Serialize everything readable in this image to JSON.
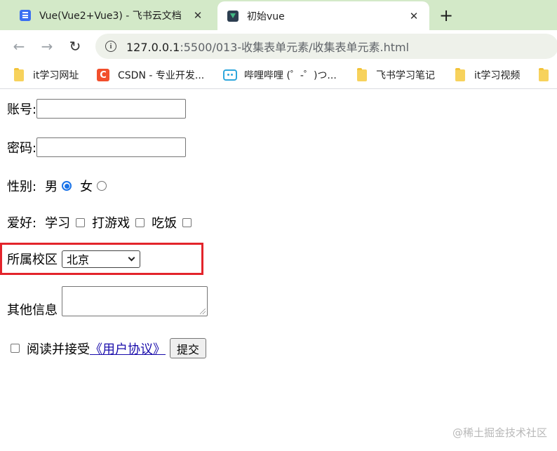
{
  "browser": {
    "tabs": [
      {
        "title": "Vue(Vue2+Vue3) - 飞书云文档",
        "icon": "doc-icon",
        "close": "✕"
      },
      {
        "title": "初始vue",
        "icon": "vue-icon",
        "close": "✕"
      }
    ],
    "new_tab": "+",
    "nav": {
      "back": "←",
      "forward": "→",
      "reload": "↻"
    },
    "url_host": "127.0.0.1",
    "url_rest": ":5500/013-收集表单元素/收集表单元素.html",
    "bookmarks": [
      {
        "label": "it学习网址",
        "icon": "folder-icon"
      },
      {
        "label": "CSDN - 专业开发...",
        "icon": "csdn-icon"
      },
      {
        "label": "哔哩哔哩 (゜-゜)つ...",
        "icon": "bilibili-icon"
      },
      {
        "label": "飞书学习笔记",
        "icon": "folder-icon"
      },
      {
        "label": "it学习视频",
        "icon": "folder-icon"
      }
    ],
    "csdn_letter": "C",
    "accent": "#1a73e8",
    "tab_bar_color": "#d3e9c8"
  },
  "form": {
    "account_label": "账号:",
    "account_value": "",
    "password_label": "密码:",
    "password_value": "",
    "gender_label": "性别:",
    "gender_options": [
      "男",
      "女"
    ],
    "gender_selected": "男",
    "hobby_label": "爱好:",
    "hobbies": [
      "学习",
      "打游戏",
      "吃饭"
    ],
    "campus_label": "所属校区",
    "campus_selected": "北京",
    "other_label": "其他信息",
    "agree_text": "阅读并接受",
    "agree_link": "《用户协议》",
    "submit_label": "提交",
    "highlight_color": "#e3242b"
  },
  "watermark": "@稀土掘金技术社区"
}
